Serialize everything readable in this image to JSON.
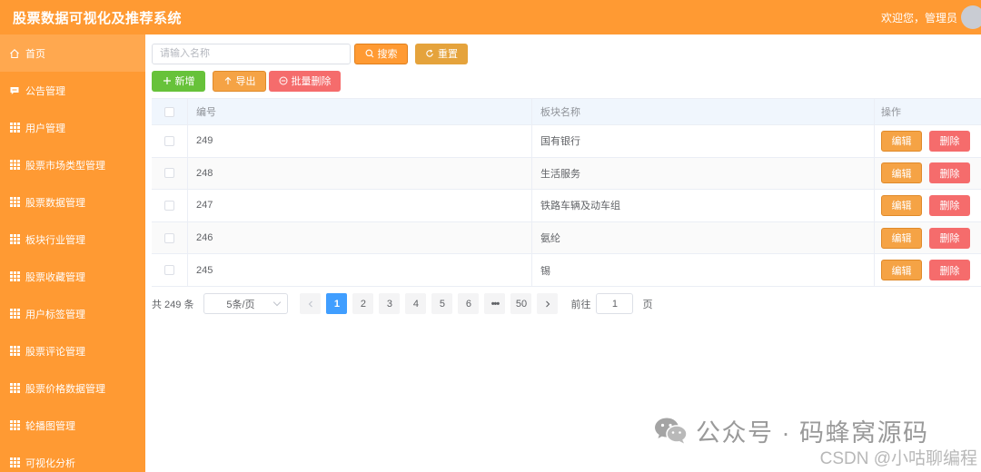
{
  "header": {
    "title": "股票数据可视化及推荐系统",
    "welcome": "欢迎您，管理员"
  },
  "sidebar": {
    "items": [
      {
        "label": "首页",
        "icon": "home-icon",
        "active": true
      },
      {
        "label": "公告管理",
        "icon": "message-icon"
      },
      {
        "label": "用户管理",
        "icon": "grid-icon"
      },
      {
        "label": "股票市场类型管理",
        "icon": "grid-icon"
      },
      {
        "label": "股票数据管理",
        "icon": "grid-icon"
      },
      {
        "label": "板块行业管理",
        "icon": "grid-icon"
      },
      {
        "label": "股票收藏管理",
        "icon": "grid-icon"
      },
      {
        "label": "用户标签管理",
        "icon": "grid-icon"
      },
      {
        "label": "股票评论管理",
        "icon": "grid-icon"
      },
      {
        "label": "股票价格数据管理",
        "icon": "grid-icon"
      },
      {
        "label": "轮播图管理",
        "icon": "grid-icon"
      },
      {
        "label": "可视化分析",
        "icon": "grid-icon"
      }
    ]
  },
  "toolbar": {
    "search_placeholder": "请输入名称",
    "search_value": "",
    "search_label": "搜索",
    "reset_label": "重置",
    "add_label": "新增",
    "export_label": "导出",
    "batch_delete_label": "批量删除"
  },
  "table": {
    "columns": [
      "编号",
      "板块名称",
      "操作"
    ],
    "edit_label": "编辑",
    "delete_label": "删除",
    "rows": [
      {
        "id": "249",
        "name": "国有银行"
      },
      {
        "id": "248",
        "name": "生活服务"
      },
      {
        "id": "247",
        "name": "铁路车辆及动车组"
      },
      {
        "id": "246",
        "name": "氨纶"
      },
      {
        "id": "245",
        "name": "锡"
      }
    ]
  },
  "pagination": {
    "total": "共 249 条",
    "page_size": "5条/页",
    "pages": [
      "1",
      "2",
      "3",
      "4",
      "5",
      "6",
      "•••",
      "50"
    ],
    "current": "1",
    "goto_label": "前往",
    "goto_value": "1",
    "goto_unit": "页"
  },
  "watermark": {
    "text": "公众号 · 码蜂窝源码",
    "csdn": "CSDN @小咕聊编程"
  },
  "colors": {
    "brand": "#ff9a33",
    "success": "#67c23a",
    "danger": "#f56c6c",
    "primary": "#409eff"
  }
}
